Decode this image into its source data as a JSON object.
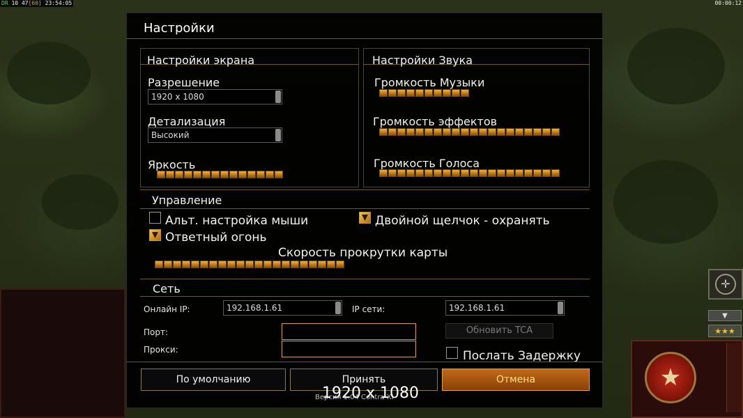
{
  "hud": {
    "status_left_a": "DR",
    "status_left_b": "10",
    "status_left_c": "47",
    "status_left_d": "[60]",
    "status_left_time": "23:54:05",
    "status_right": "00:00:12"
  },
  "dialog": {
    "title": "Настройки",
    "screen": {
      "header": "Настройки экрана",
      "resolution_label": "Разрешение",
      "resolution_value": "1920 x 1080",
      "detail_label": "Детализация",
      "detail_value": "Высокий",
      "brightness_label": "Яркость",
      "brightness_level": 1.0
    },
    "sound": {
      "header": "Настройки Звука",
      "music_label": "Громкость Музыки",
      "music_level": 1.0,
      "effects_label": "Громкость эффектов",
      "effects_level": 1.0,
      "voice_label": "Громкость Голоса",
      "voice_level": 1.0
    },
    "controls": {
      "header": "Управление",
      "alt_mouse_label": "Альт. настройка мыши",
      "alt_mouse_checked": false,
      "double_click_label": "Двойной щелчок - охранять",
      "double_click_checked": true,
      "return_fire_label": "Ответный огонь",
      "return_fire_checked": true,
      "scroll_speed_label": "Скорость прокрутки карты",
      "scroll_speed_level": 1.0
    },
    "network": {
      "header": "Сеть",
      "online_ip_label": "Онлайн IP:",
      "online_ip_value": "192.168.1.61",
      "lan_ip_label": "IP сети:",
      "lan_ip_value": "192.168.1.61",
      "port_label": "Порт:",
      "port_value": "",
      "proxy_label": "Прокси:",
      "proxy_value": "",
      "update_tca_label": "Обновить TCA",
      "send_delay_label": "Послать Задержку",
      "send_delay_checked": false
    },
    "buttons": {
      "defaults": "По умолчанию",
      "accept": "Принять",
      "cancel": "Отмена"
    },
    "overlay_resolution": "1920 x 1080",
    "version_text": "Версия 1.04 Contra XI"
  },
  "colors": {
    "accent_orange": "#c06a18",
    "slider_gold": "#f2b23a",
    "frame_line": "#6b5a2a"
  }
}
